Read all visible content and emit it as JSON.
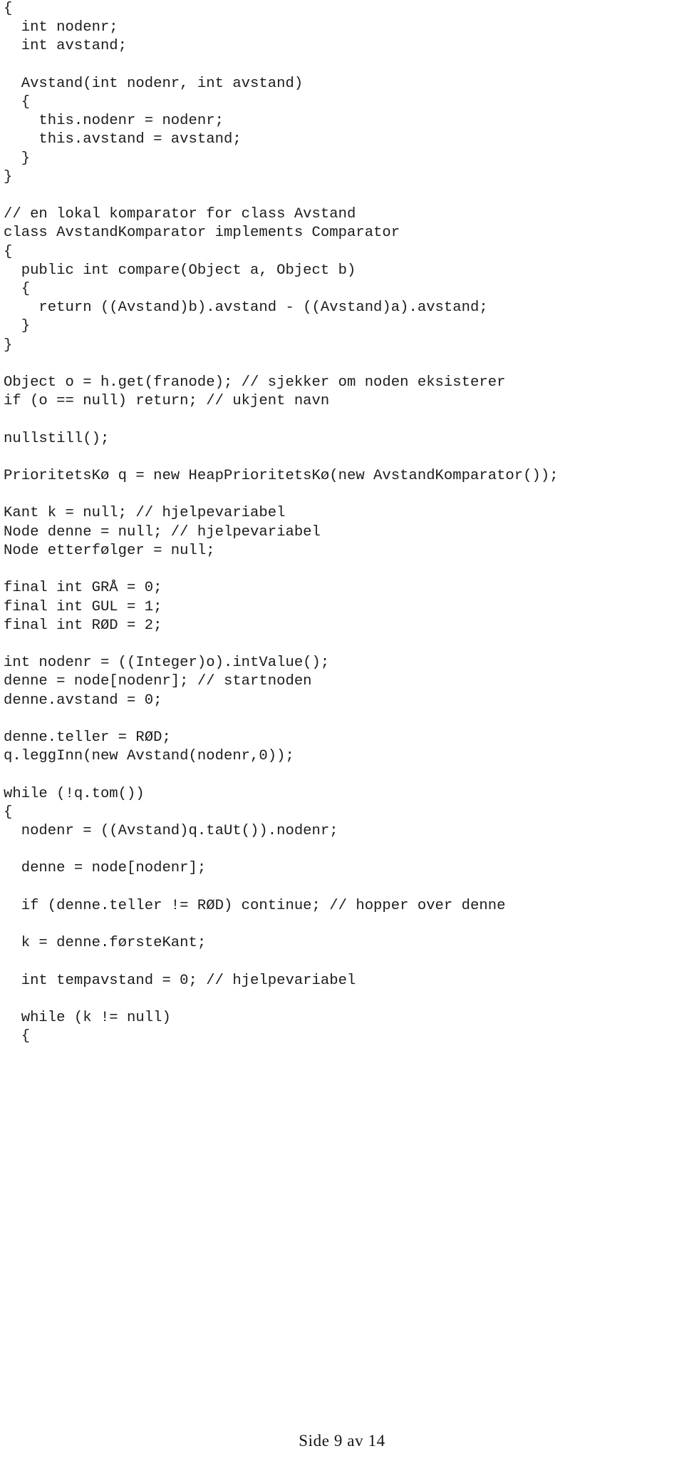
{
  "document": {
    "kind": "scanned-code-listing",
    "language": "Java",
    "background_color": "#ffffff",
    "text_color": "#1c1c1c",
    "footer": {
      "text": "Side 9 av 14",
      "page_number": 9,
      "total_pages": 14
    }
  },
  "code": {
    "lines": [
      "{",
      "  int nodenr;",
      "  int avstand;",
      "",
      "  Avstand(int nodenr, int avstand)",
      "  {",
      "    this.nodenr = nodenr;",
      "    this.avstand = avstand;",
      "  }",
      "}",
      "",
      "// en lokal komparator for class Avstand",
      "class AvstandKomparator implements Comparator",
      "{",
      "  public int compare(Object a, Object b)",
      "  {",
      "    return ((Avstand)b).avstand - ((Avstand)a).avstand;",
      "  }",
      "}",
      "",
      "Object o = h.get(franode); // sjekker om noden eksisterer",
      "if (o == null) return; // ukjent navn",
      "",
      "nullstill();",
      "",
      "PrioritetsKø q = new HeapPrioritetsKø(new AvstandKomparator());",
      "",
      "Kant k = null; // hjelpevariabel",
      "Node denne = null; // hjelpevariabel",
      "Node etterfølger = null;",
      "",
      "final int GRÅ = 0;",
      "final int GUL = 1;",
      "final int RØD = 2;",
      "",
      "int nodenr = ((Integer)o).intValue();",
      "denne = node[nodenr]; // startnoden",
      "denne.avstand = 0;",
      "",
      "denne.teller = RØD;",
      "q.leggInn(new Avstand(nodenr,0));",
      "",
      "while (!q.tom())",
      "{",
      "  nodenr = ((Avstand)q.taUt()).nodenr;",
      "",
      "  denne = node[nodenr];",
      "",
      "  if (denne.teller != RØD) continue; // hopper over denne",
      "",
      "  k = denne.førsteKant;",
      "",
      "  int tempavstand = 0; // hjelpevariabel",
      "",
      "  while (k != null)",
      "  {"
    ]
  }
}
